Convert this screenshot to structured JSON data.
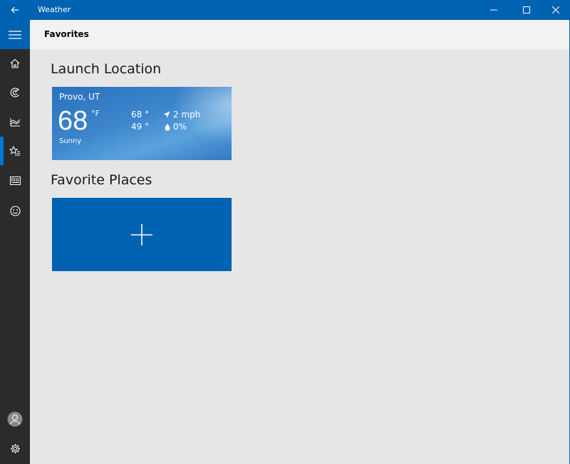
{
  "window": {
    "title": "Weather"
  },
  "header": {
    "title": "Favorites"
  },
  "nav": [
    {
      "name": "home-icon",
      "label": "Forecast"
    },
    {
      "name": "maps-icon",
      "label": "Maps"
    },
    {
      "name": "historical-icon",
      "label": "Historical Weather"
    },
    {
      "name": "favorites-icon",
      "label": "Favorites",
      "active": true
    },
    {
      "name": "news-icon",
      "label": "News"
    },
    {
      "name": "feedback-icon",
      "label": "Send Feedback"
    }
  ],
  "sections": {
    "launch_title": "Launch Location",
    "favorites_title": "Favorite Places"
  },
  "launch_tile": {
    "location": "Provo, UT",
    "temperature": "68",
    "unit": "°F",
    "high": "68 °",
    "low": "49 °",
    "wind": "2 mph",
    "precipitation": "0%",
    "condition": "Sunny"
  },
  "colors": {
    "accent": "#0063b1",
    "sidebar": "#2b2b2b",
    "background": "#e6e6e6",
    "header": "#f2f2f2"
  }
}
